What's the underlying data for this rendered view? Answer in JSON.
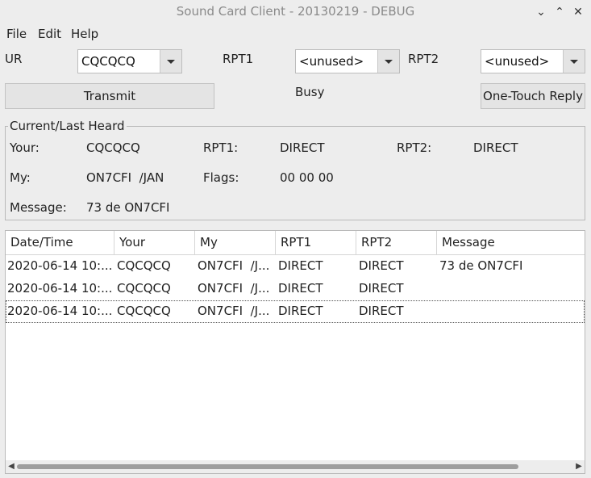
{
  "window": {
    "title": "Sound Card Client - 20130219 - DEBUG",
    "controls": {
      "minimize": "⌄",
      "maximize": "⌃",
      "close": "✕"
    }
  },
  "menu": [
    "File",
    "Edit",
    "Help"
  ],
  "form": {
    "ur_label": "UR",
    "ur_value": "CQCQCQ",
    "rpt1_label": "RPT1",
    "rpt1_value": "<unused>",
    "rpt2_label": "RPT2",
    "rpt2_value": "<unused>",
    "transmit_label": "Transmit",
    "status_text": "Busy",
    "one_touch_label": "One-Touch Reply"
  },
  "heard": {
    "group_title": "Current/Last Heard",
    "your_label": "Your:",
    "your_value": "CQCQCQ",
    "rpt1_label": "RPT1:",
    "rpt1_value": "DIRECT",
    "rpt2_label": "RPT2:",
    "rpt2_value": "DIRECT",
    "my_label": "My:",
    "my_value": "ON7CFI  /JAN",
    "flags_label": "Flags:",
    "flags_value": "00 00 00",
    "message_label": "Message:",
    "message_value": "73 de ON7CFI"
  },
  "table": {
    "columns": [
      "Date/Time",
      "Your",
      "My",
      "RPT1",
      "RPT2",
      "Message"
    ],
    "rows": [
      [
        "2020-06-14 10:...",
        "CQCQCQ",
        "ON7CFI  /J...",
        "DIRECT",
        "DIRECT",
        "73 de ON7CFI"
      ],
      [
        "2020-06-14 10:...",
        "CQCQCQ",
        "ON7CFI  /J...",
        "DIRECT",
        "DIRECT",
        ""
      ],
      [
        "2020-06-14 10:...",
        "CQCQCQ",
        "ON7CFI  /J...",
        "DIRECT",
        "DIRECT",
        ""
      ]
    ]
  },
  "scrollbar": {
    "left_arrow": "◀",
    "right_arrow": "▶"
  }
}
